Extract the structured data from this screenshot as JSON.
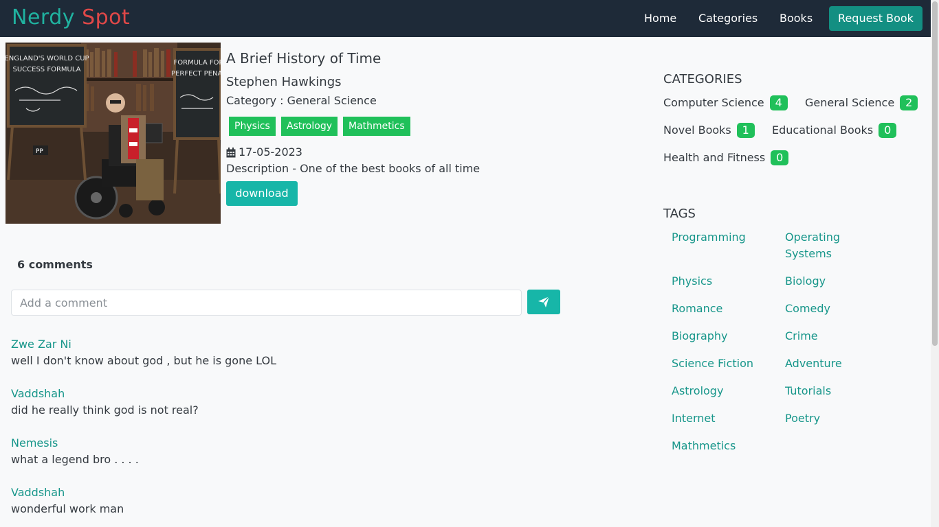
{
  "nav": {
    "brand_part1": "Nerdy",
    "brand_part2": "Spot",
    "links": [
      "Home",
      "Categories",
      "Books"
    ],
    "request_button": "Request Book"
  },
  "book": {
    "title": "A Brief History of Time",
    "author": "Stephen Hawkings",
    "category_line": "Category : General Science",
    "tags": [
      "Physics",
      "Astrology",
      "Mathmetics"
    ],
    "date": "17-05-2023",
    "description": "Description - One of the best books of all time",
    "download_label": "download",
    "cover_text_left": [
      "ENGLAND'S WORLD CUP",
      "SUCCESS FORMULA"
    ],
    "cover_text_right": [
      "FORMULA FOR",
      "PERFECT PENAL"
    ]
  },
  "comments": {
    "count_label": "6 comments",
    "input_placeholder": "Add a comment",
    "items": [
      {
        "name": "Zwe Zar Ni",
        "text": "well I don't know about god , but he is gone LOL"
      },
      {
        "name": "Vaddshah",
        "text": "did he really think god is not real?"
      },
      {
        "name": "Nemesis",
        "text": "what a legend bro . . . ."
      },
      {
        "name": "Vaddshah",
        "text": "wonderful work man"
      }
    ]
  },
  "sidebar": {
    "categories_heading": "CATEGORIES",
    "categories": [
      {
        "name": "Computer Science",
        "count": "4"
      },
      {
        "name": "General Science",
        "count": "2"
      },
      {
        "name": "Novel Books",
        "count": "1"
      },
      {
        "name": "Educational Books",
        "count": "0"
      },
      {
        "name": "Health and Fitness",
        "count": "0"
      }
    ],
    "tags_heading": "TAGS",
    "tags": [
      "Programming",
      "Operating Systems",
      "Physics",
      "Biology",
      "Romance",
      "Comedy",
      "Biography",
      "Crime",
      "Science Fiction",
      "Adventure",
      "Astrology",
      "Tutorials",
      "Internet",
      "Poetry",
      "Mathmetics"
    ]
  },
  "colors": {
    "navbar": "#1e2a38",
    "brand_teal": "#20b2a0",
    "brand_red": "#e04848",
    "accent": "#17b6a8",
    "badge_green": "#20c05a",
    "link_teal": "#17968a"
  },
  "icons": {
    "calendar": "calendar-icon",
    "send": "paper-plane-icon"
  }
}
